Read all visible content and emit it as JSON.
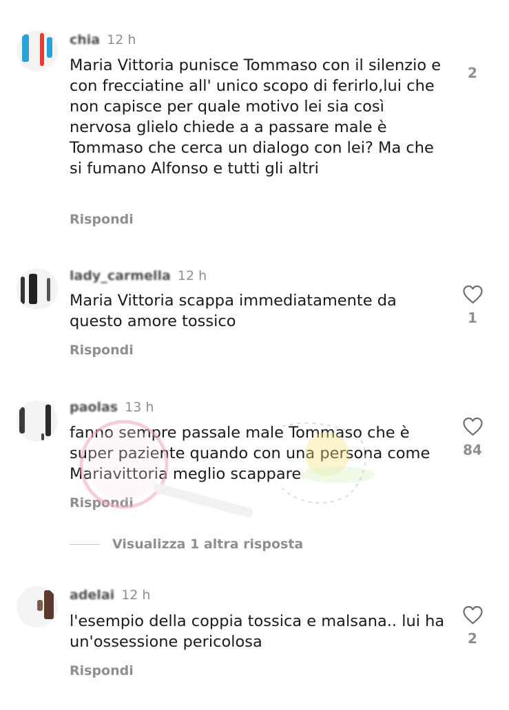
{
  "comments": [
    {
      "username": "chia",
      "time": "12 h",
      "text": "Maria Vittoria punisce Tommaso con il silenzio e con frecciatine all' unico scopo di ferirlo,lui che non capisce per quale motivo lei sia così nervosa glielo chiede a a passare male è Tommaso che cerca un dialogo con lei? Ma che si fumano Alfonso e tutti gli altri",
      "likes": "2",
      "reply_label": "Rispondi"
    },
    {
      "username": "lady_carmella",
      "time": "12 h",
      "text": "Maria Vittoria scappa immediatamente da questo amore tossico",
      "likes": "1",
      "reply_label": "Rispondi"
    },
    {
      "username": "paolas",
      "time": "13 h",
      "text": "fanno sempre passale male Tommaso che è super paziente quando con una persona come Mariavittoria meglio scappare",
      "likes": "84",
      "reply_label": "Rispondi"
    },
    {
      "username": "adelai",
      "time": "12 h",
      "text": "l'esempio della coppia tossica e malsana.. lui ha un'ossessione pericolosa",
      "likes": "2",
      "reply_label": "Rispondi"
    }
  ],
  "view_more_replies": "Visualizza 1 altra risposta",
  "colors": {
    "text": "#1a1a1a",
    "secondary": "#8e8e8e",
    "divider": "#c7c7c7",
    "background": "#ffffff"
  },
  "icons": {
    "like": "heart-outline-icon"
  }
}
